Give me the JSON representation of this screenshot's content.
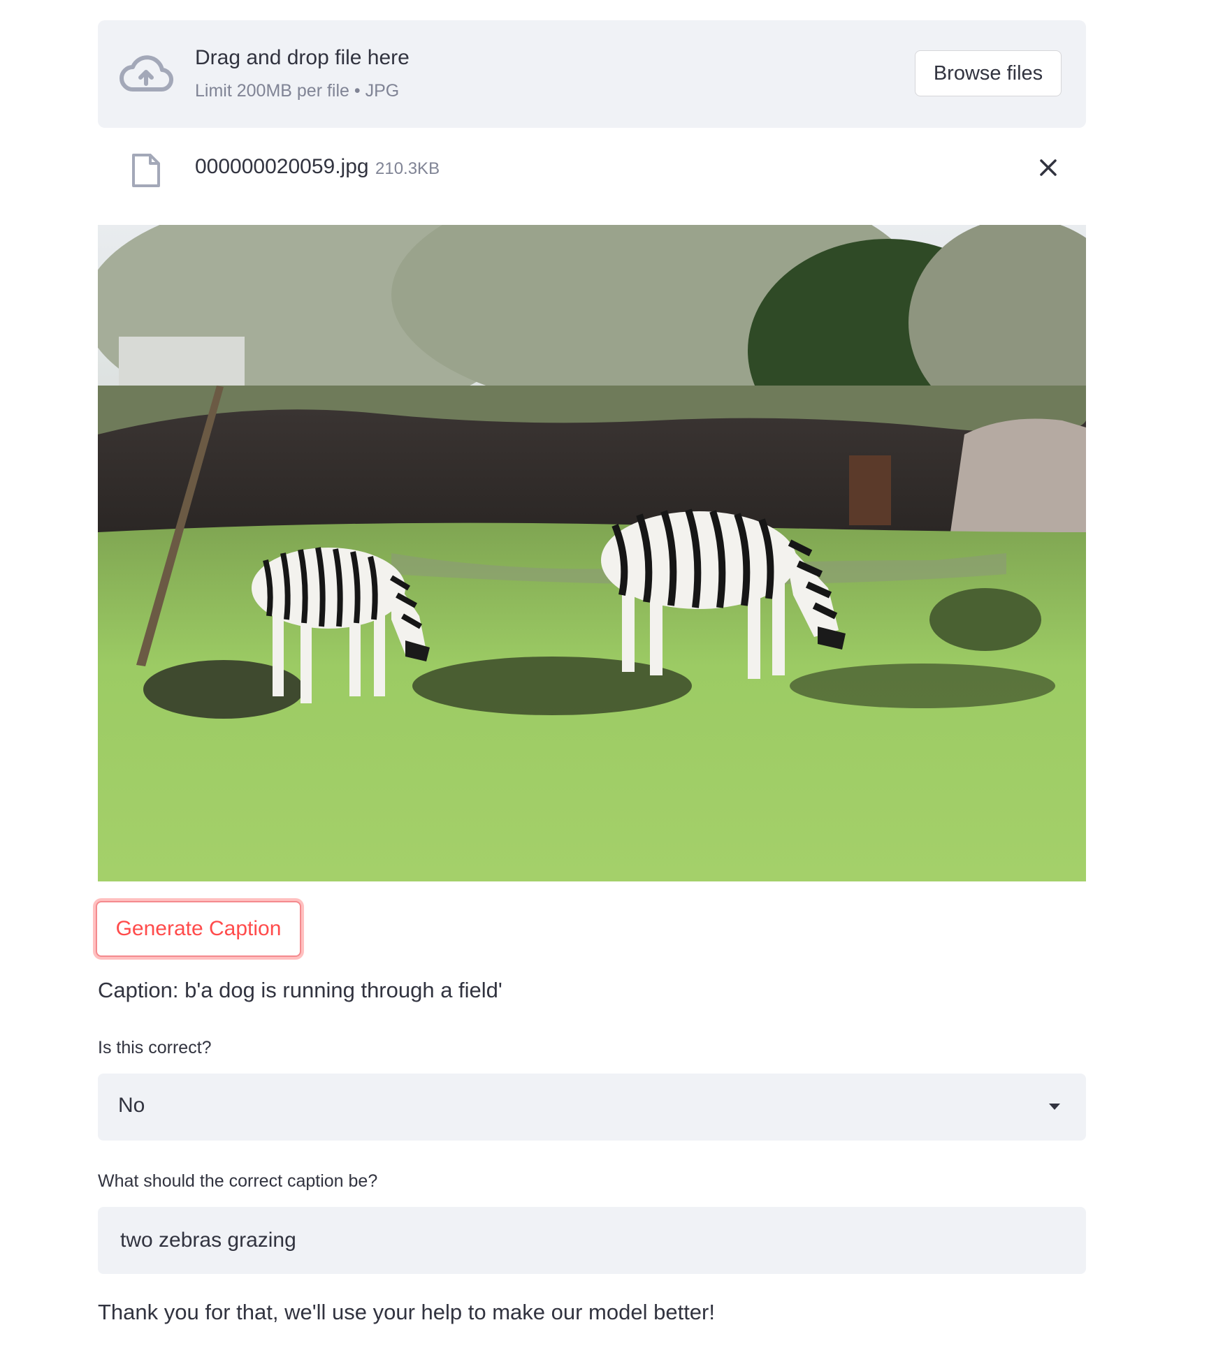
{
  "uploader": {
    "drop_title": "Drag and drop file here",
    "drop_subtitle": "Limit 200MB per file • JPG",
    "browse_label": "Browse files",
    "file": {
      "name": "000000020059.jpg",
      "size": "210.3KB"
    }
  },
  "image": {
    "icon": "uploaded-photo"
  },
  "actions": {
    "generate_label": "Generate Caption"
  },
  "result": {
    "caption": "Caption: b'a dog is running through a field'"
  },
  "feedback": {
    "correct_label": "Is this correct?",
    "correct_value": "No",
    "correction_label": "What should the correct caption be?",
    "correction_value": "two zebras grazing",
    "thanks": "Thank you for that, we'll use your help to make our model better!"
  },
  "colors": {
    "accent": "#ff4b4b",
    "panel": "#f0f2f6",
    "text": "#31333f",
    "muted": "#808495"
  }
}
